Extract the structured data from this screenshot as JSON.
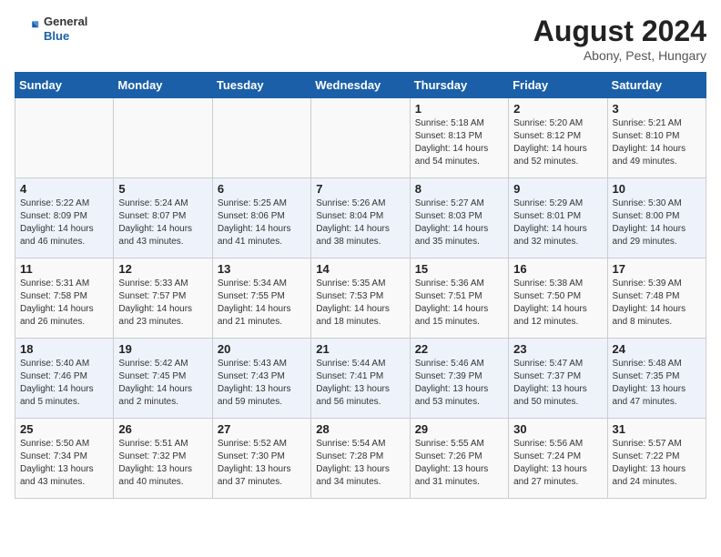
{
  "header": {
    "logo_general": "General",
    "logo_blue": "Blue",
    "month_year": "August 2024",
    "location": "Abony, Pest, Hungary"
  },
  "days_of_week": [
    "Sunday",
    "Monday",
    "Tuesday",
    "Wednesday",
    "Thursday",
    "Friday",
    "Saturday"
  ],
  "weeks": [
    [
      {
        "day": "",
        "content": ""
      },
      {
        "day": "",
        "content": ""
      },
      {
        "day": "",
        "content": ""
      },
      {
        "day": "",
        "content": ""
      },
      {
        "day": "1",
        "content": "Sunrise: 5:18 AM\nSunset: 8:13 PM\nDaylight: 14 hours\nand 54 minutes."
      },
      {
        "day": "2",
        "content": "Sunrise: 5:20 AM\nSunset: 8:12 PM\nDaylight: 14 hours\nand 52 minutes."
      },
      {
        "day": "3",
        "content": "Sunrise: 5:21 AM\nSunset: 8:10 PM\nDaylight: 14 hours\nand 49 minutes."
      }
    ],
    [
      {
        "day": "4",
        "content": "Sunrise: 5:22 AM\nSunset: 8:09 PM\nDaylight: 14 hours\nand 46 minutes."
      },
      {
        "day": "5",
        "content": "Sunrise: 5:24 AM\nSunset: 8:07 PM\nDaylight: 14 hours\nand 43 minutes."
      },
      {
        "day": "6",
        "content": "Sunrise: 5:25 AM\nSunset: 8:06 PM\nDaylight: 14 hours\nand 41 minutes."
      },
      {
        "day": "7",
        "content": "Sunrise: 5:26 AM\nSunset: 8:04 PM\nDaylight: 14 hours\nand 38 minutes."
      },
      {
        "day": "8",
        "content": "Sunrise: 5:27 AM\nSunset: 8:03 PM\nDaylight: 14 hours\nand 35 minutes."
      },
      {
        "day": "9",
        "content": "Sunrise: 5:29 AM\nSunset: 8:01 PM\nDaylight: 14 hours\nand 32 minutes."
      },
      {
        "day": "10",
        "content": "Sunrise: 5:30 AM\nSunset: 8:00 PM\nDaylight: 14 hours\nand 29 minutes."
      }
    ],
    [
      {
        "day": "11",
        "content": "Sunrise: 5:31 AM\nSunset: 7:58 PM\nDaylight: 14 hours\nand 26 minutes."
      },
      {
        "day": "12",
        "content": "Sunrise: 5:33 AM\nSunset: 7:57 PM\nDaylight: 14 hours\nand 23 minutes."
      },
      {
        "day": "13",
        "content": "Sunrise: 5:34 AM\nSunset: 7:55 PM\nDaylight: 14 hours\nand 21 minutes."
      },
      {
        "day": "14",
        "content": "Sunrise: 5:35 AM\nSunset: 7:53 PM\nDaylight: 14 hours\nand 18 minutes."
      },
      {
        "day": "15",
        "content": "Sunrise: 5:36 AM\nSunset: 7:51 PM\nDaylight: 14 hours\nand 15 minutes."
      },
      {
        "day": "16",
        "content": "Sunrise: 5:38 AM\nSunset: 7:50 PM\nDaylight: 14 hours\nand 12 minutes."
      },
      {
        "day": "17",
        "content": "Sunrise: 5:39 AM\nSunset: 7:48 PM\nDaylight: 14 hours\nand 8 minutes."
      }
    ],
    [
      {
        "day": "18",
        "content": "Sunrise: 5:40 AM\nSunset: 7:46 PM\nDaylight: 14 hours\nand 5 minutes."
      },
      {
        "day": "19",
        "content": "Sunrise: 5:42 AM\nSunset: 7:45 PM\nDaylight: 14 hours\nand 2 minutes."
      },
      {
        "day": "20",
        "content": "Sunrise: 5:43 AM\nSunset: 7:43 PM\nDaylight: 13 hours\nand 59 minutes."
      },
      {
        "day": "21",
        "content": "Sunrise: 5:44 AM\nSunset: 7:41 PM\nDaylight: 13 hours\nand 56 minutes."
      },
      {
        "day": "22",
        "content": "Sunrise: 5:46 AM\nSunset: 7:39 PM\nDaylight: 13 hours\nand 53 minutes."
      },
      {
        "day": "23",
        "content": "Sunrise: 5:47 AM\nSunset: 7:37 PM\nDaylight: 13 hours\nand 50 minutes."
      },
      {
        "day": "24",
        "content": "Sunrise: 5:48 AM\nSunset: 7:35 PM\nDaylight: 13 hours\nand 47 minutes."
      }
    ],
    [
      {
        "day": "25",
        "content": "Sunrise: 5:50 AM\nSunset: 7:34 PM\nDaylight: 13 hours\nand 43 minutes."
      },
      {
        "day": "26",
        "content": "Sunrise: 5:51 AM\nSunset: 7:32 PM\nDaylight: 13 hours\nand 40 minutes."
      },
      {
        "day": "27",
        "content": "Sunrise: 5:52 AM\nSunset: 7:30 PM\nDaylight: 13 hours\nand 37 minutes."
      },
      {
        "day": "28",
        "content": "Sunrise: 5:54 AM\nSunset: 7:28 PM\nDaylight: 13 hours\nand 34 minutes."
      },
      {
        "day": "29",
        "content": "Sunrise: 5:55 AM\nSunset: 7:26 PM\nDaylight: 13 hours\nand 31 minutes."
      },
      {
        "day": "30",
        "content": "Sunrise: 5:56 AM\nSunset: 7:24 PM\nDaylight: 13 hours\nand 27 minutes."
      },
      {
        "day": "31",
        "content": "Sunrise: 5:57 AM\nSunset: 7:22 PM\nDaylight: 13 hours\nand 24 minutes."
      }
    ]
  ]
}
